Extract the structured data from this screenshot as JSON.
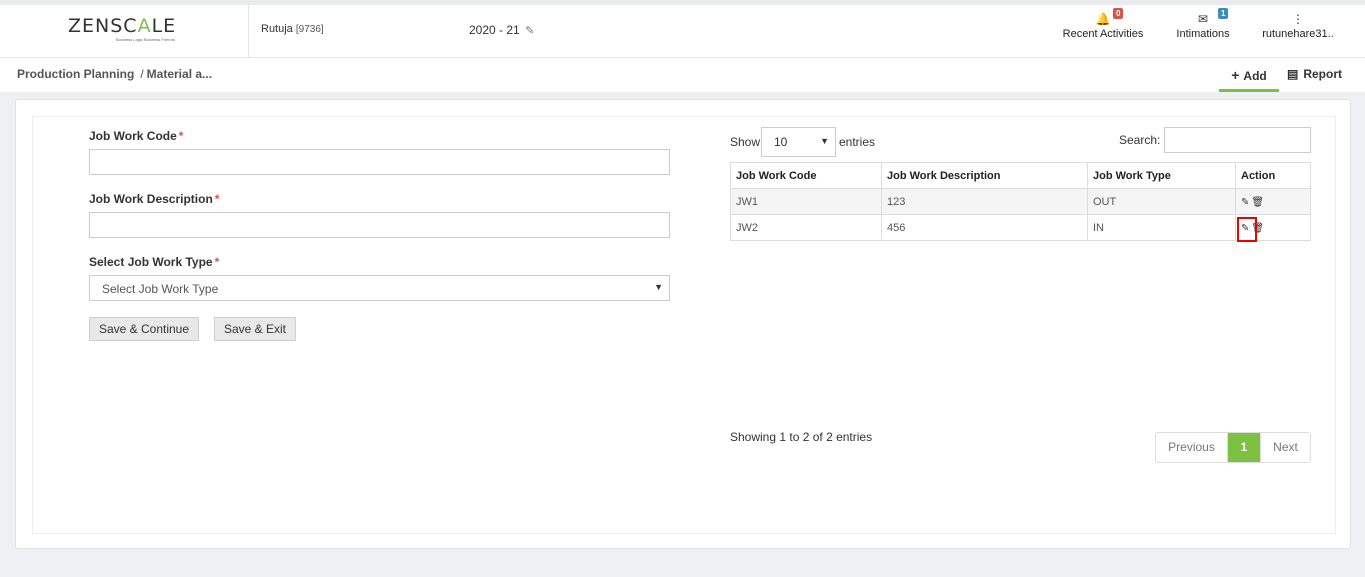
{
  "header": {
    "logo_main": "ZENSC",
    "logo_accent": "A",
    "logo_end": "LE",
    "logo_tagline": "Business Logic Business Friends",
    "user_name": "Rutuja",
    "user_id": "[9736]",
    "fiscal_year": "2020 - 21",
    "recent_activities": {
      "label": "Recent Activities",
      "count": "0"
    },
    "intimations": {
      "label": "Intimations",
      "count": "1"
    },
    "account": {
      "label": "rutunehare31.."
    }
  },
  "breadcrumb": {
    "root": "Production Planning",
    "current": "Material a..."
  },
  "tabs": {
    "add": "Add",
    "report": "Report"
  },
  "form": {
    "code_label": "Job Work Code",
    "desc_label": "Job Work Description",
    "type_label": "Select Job Work Type",
    "type_placeholder": "Select Job Work Type",
    "required_mark": "*",
    "save_continue": "Save & Continue",
    "save_exit": "Save & Exit"
  },
  "list": {
    "show_label": "Show",
    "page_size": "10",
    "entries_label": "entries",
    "search_label": "Search:",
    "columns": [
      "Job Work Code",
      "Job Work Description",
      "Job Work Type",
      "Action"
    ],
    "rows": [
      {
        "code": "JW1",
        "desc": "123",
        "type": "OUT"
      },
      {
        "code": "JW2",
        "desc": "456",
        "type": "IN"
      }
    ],
    "info": "Showing 1 to 2 of 2 entries",
    "prev": "Previous",
    "page": "1",
    "next": "Next"
  }
}
